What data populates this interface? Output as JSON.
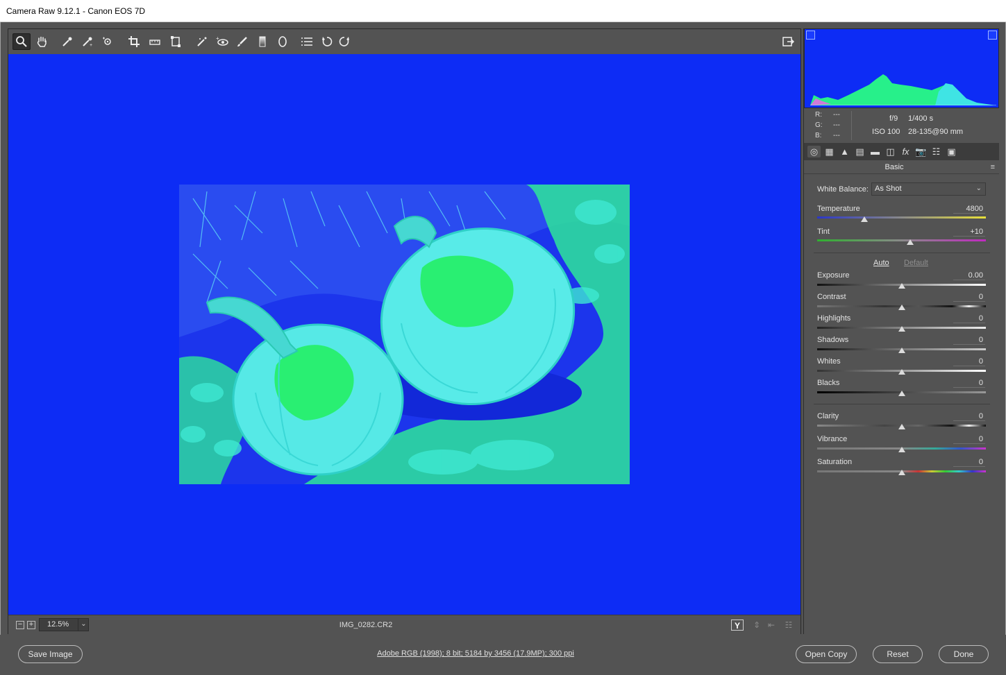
{
  "window": {
    "title": "Camera Raw 9.12.1  -  Canon EOS 7D"
  },
  "toolbar": {
    "tools": [
      {
        "name": "zoom-tool",
        "glyph": "🔍"
      },
      {
        "name": "hand-tool",
        "glyph": "✋"
      },
      {
        "name": "white-balance-tool",
        "glyph": "✒"
      },
      {
        "name": "color-sampler-tool",
        "glyph": "✒"
      },
      {
        "name": "targeted-adjustment-tool",
        "glyph": "⊙"
      },
      {
        "name": "crop-tool",
        "glyph": "⌗"
      },
      {
        "name": "straighten-tool",
        "glyph": "▭"
      },
      {
        "name": "transform-tool",
        "glyph": "⬚"
      },
      {
        "name": "spot-removal-tool",
        "glyph": "✎"
      },
      {
        "name": "red-eye-tool",
        "glyph": "◉"
      },
      {
        "name": "adjustment-brush-tool",
        "glyph": "🖌"
      },
      {
        "name": "graduated-filter-tool",
        "glyph": "▮"
      },
      {
        "name": "radial-filter-tool",
        "glyph": "◯"
      },
      {
        "name": "preferences-tool",
        "glyph": "☰"
      },
      {
        "name": "rotate-ccw-tool",
        "glyph": "↺"
      },
      {
        "name": "rotate-cw-tool",
        "glyph": "↻"
      }
    ],
    "fullscreen_glyph": "⇱"
  },
  "preview": {
    "zoom": "12.5%",
    "filename": "IMG_0282.CR2",
    "zoom_out": "−",
    "zoom_in": "+",
    "zoom_drop": "⌄"
  },
  "readout": {
    "r": "R:",
    "r_val": "---",
    "g": "G:",
    "g_val": "---",
    "b": "B:",
    "b_val": "---",
    "aperture": "f/9",
    "shutter": "1/400 s",
    "iso": "ISO 100",
    "lens": "28-135@90 mm"
  },
  "panel": {
    "title": "Basic",
    "menu_glyph": "≡",
    "tab_glyphs": [
      "◎",
      "▦",
      "▲",
      "▤",
      "▬",
      "◫",
      "fx",
      "📷",
      "☷",
      "▣"
    ],
    "white_balance_label": "White Balance:",
    "white_balance_value": "As Shot",
    "chevron": "⌄",
    "auto_label": "Auto",
    "default_label": "Default",
    "sliders": [
      {
        "key": "temperature",
        "label": "Temperature",
        "value": "4800",
        "pos": 0.28
      },
      {
        "key": "tint",
        "label": "Tint",
        "value": "+10",
        "pos": 0.55
      },
      {
        "key": "exposure",
        "label": "Exposure",
        "value": "0.00",
        "pos": 0.5
      },
      {
        "key": "contrast",
        "label": "Contrast",
        "value": "0",
        "pos": 0.5
      },
      {
        "key": "highlights",
        "label": "Highlights",
        "value": "0",
        "pos": 0.5
      },
      {
        "key": "shadows",
        "label": "Shadows",
        "value": "0",
        "pos": 0.5
      },
      {
        "key": "whites",
        "label": "Whites",
        "value": "0",
        "pos": 0.5
      },
      {
        "key": "blacks",
        "label": "Blacks",
        "value": "0",
        "pos": 0.5
      },
      {
        "key": "clarity",
        "label": "Clarity",
        "value": "0",
        "pos": 0.5
      },
      {
        "key": "vibrance",
        "label": "Vibrance",
        "value": "0",
        "pos": 0.5
      },
      {
        "key": "saturation",
        "label": "Saturation",
        "value": "0",
        "pos": 0.5
      }
    ]
  },
  "bottom_icons": [
    "Y",
    "⇕",
    "⇤",
    "☷"
  ],
  "footer": {
    "save": "Save Image",
    "workflow": "Adobe RGB (1998); 8 bit; 5184 by 3456 (17.9MP); 300 ppi",
    "open": "Open Copy",
    "reset": "Reset",
    "done": "Done"
  },
  "colors": {
    "canvas": "#0d2cf5",
    "panel": "#535353",
    "photo_blue": "#1a30ee",
    "photo_green": "#26f58a",
    "photo_cyan": "#4ff0f0"
  }
}
